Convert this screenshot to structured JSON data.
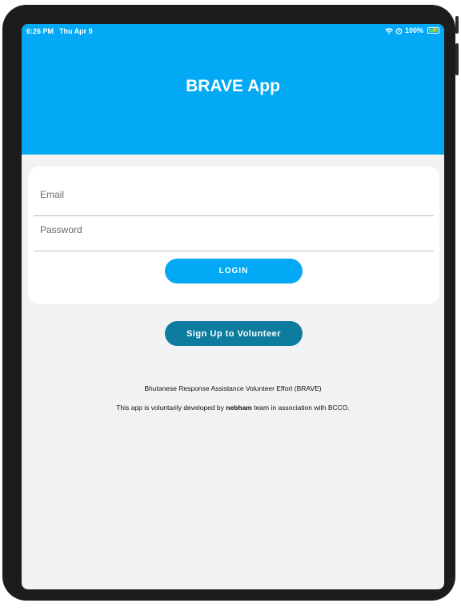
{
  "status_bar": {
    "time": "6:26 PM",
    "date": "Thu Apr 9",
    "battery": "100%",
    "wifi_icon": "wifi-icon",
    "alarm_icon": "alarm-icon",
    "battery_icon": "battery-charging-icon"
  },
  "header": {
    "title": "BRAVE App",
    "color": "#03a9f4"
  },
  "login_form": {
    "email_placeholder": "Email",
    "email_value": "",
    "password_placeholder": "Password",
    "password_value": "",
    "login_label": "LOGIN"
  },
  "signup": {
    "label": "Sign Up to Volunteer",
    "color": "#0d7c9e"
  },
  "footer": {
    "org_name": "Bhutanese Response Assistance Volunteer Effort (BRAVE)",
    "credit_prefix": "This app is voluntarily developed by ",
    "credit_team": "nebham",
    "credit_suffix": " team in association with BCCO."
  }
}
